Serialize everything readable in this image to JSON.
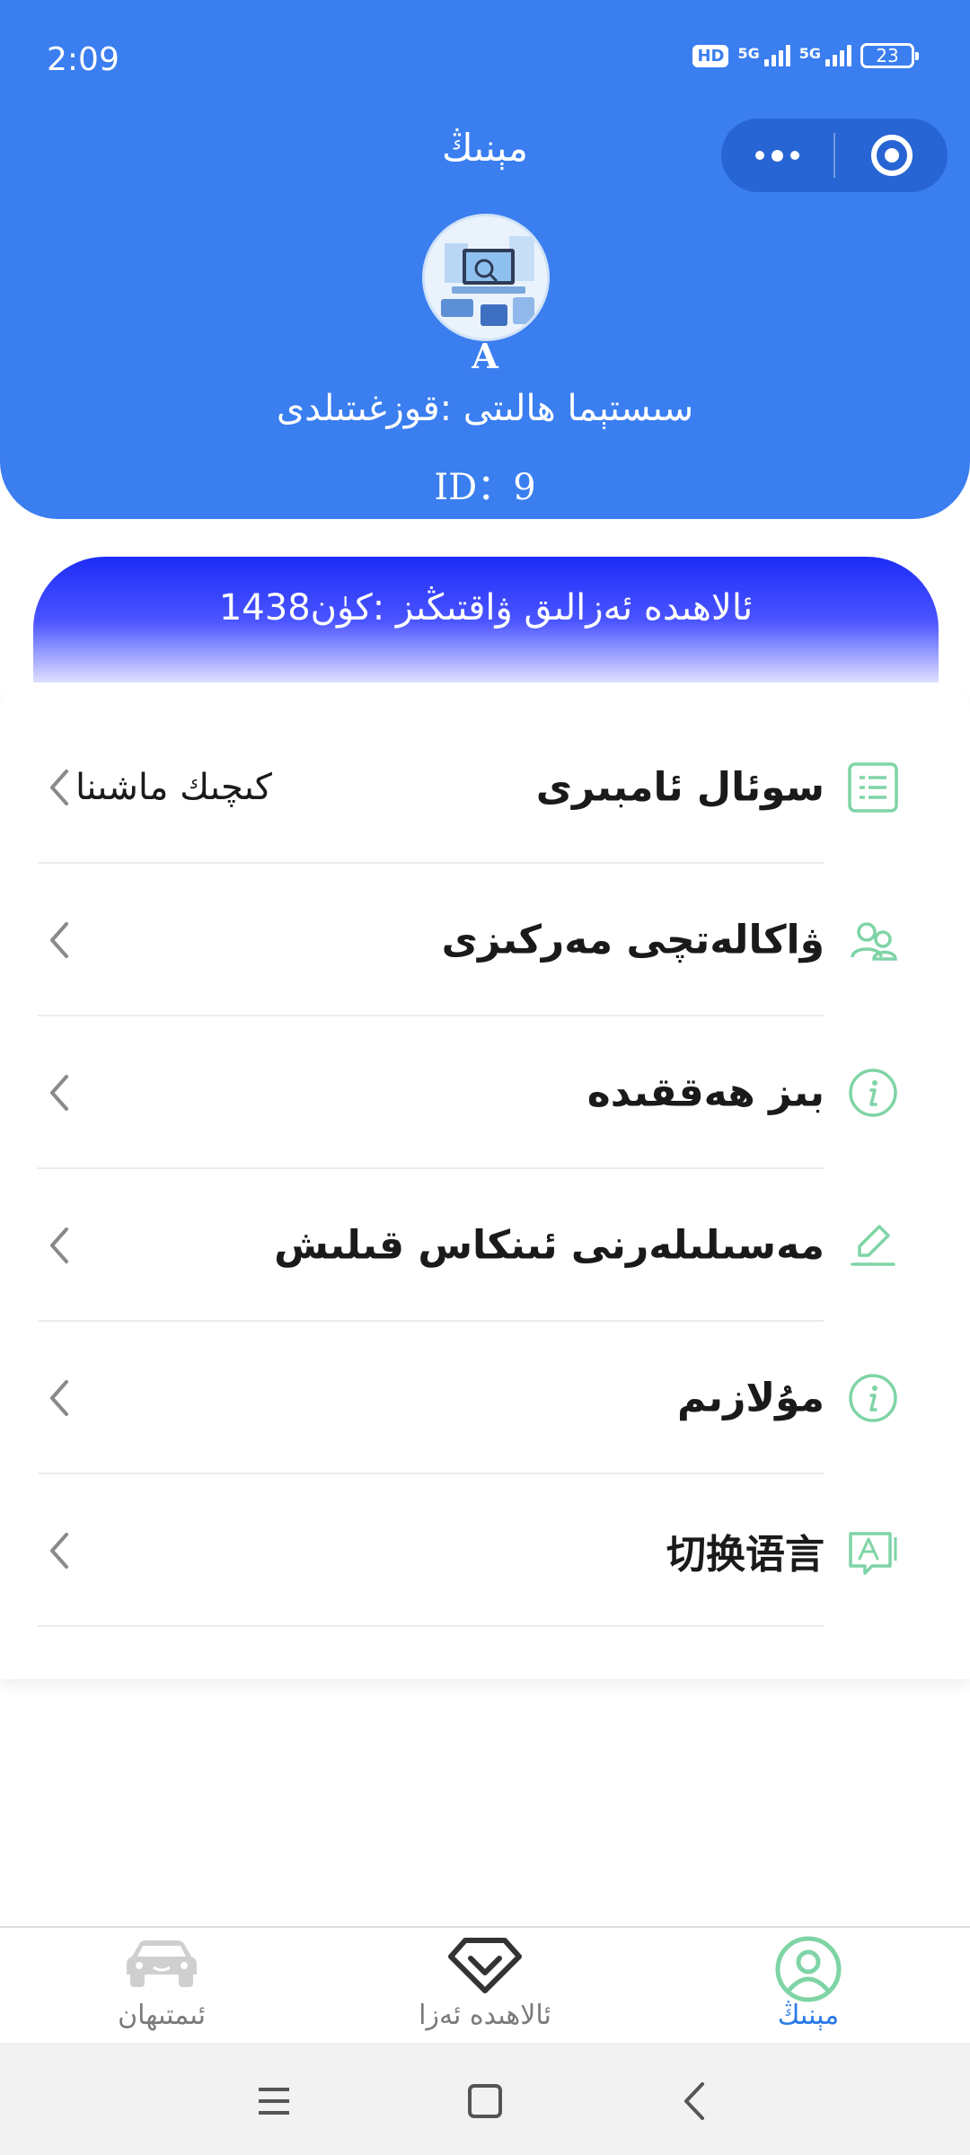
{
  "status_bar": {
    "time": "2:09",
    "hd": "HD",
    "network_1": "5G",
    "network_2": "5G",
    "battery": "23"
  },
  "header": {
    "title": "مېنىڭ",
    "avatar_letter": "A",
    "system_status": "سىستېما ھالىتى :قوزغىتىلدى",
    "user_id": "ID：9"
  },
  "vip_banner": {
    "text": "ئالاھىدە ئەزالىق ۋاقتىڭىز :كۈن1438"
  },
  "menu": {
    "items": [
      {
        "label": "سوئال ئامبىرى",
        "value": "كىچىك ماشىنا",
        "icon": "list-icon"
      },
      {
        "label": "ۋاكالەتچى مەركىزى",
        "value": "",
        "icon": "users-icon"
      },
      {
        "label": "بىز ھەققىدە",
        "value": "",
        "icon": "info-icon"
      },
      {
        "label": "مەسىلىلەرنى ئىنكاس قىلىش",
        "value": "",
        "icon": "edit-icon"
      },
      {
        "label": "مۇلازىم",
        "value": "",
        "icon": "info-icon"
      },
      {
        "label": "切换语言",
        "value": "",
        "icon": "translate-icon"
      }
    ]
  },
  "tabbar": {
    "tabs": [
      {
        "label": "ئىمتىھان",
        "icon": "car-icon",
        "active": false
      },
      {
        "label": "ئالاھىدە ئەزا",
        "icon": "diamond-icon",
        "active": false
      },
      {
        "label": "مېنىڭ",
        "icon": "profile-icon",
        "active": true
      }
    ]
  },
  "colors": {
    "header_blue": "#3a7ef0",
    "banner_blue": "#1d2cf7",
    "icon_green": "#7fd4a6",
    "active_tab": "#2a7be8"
  }
}
